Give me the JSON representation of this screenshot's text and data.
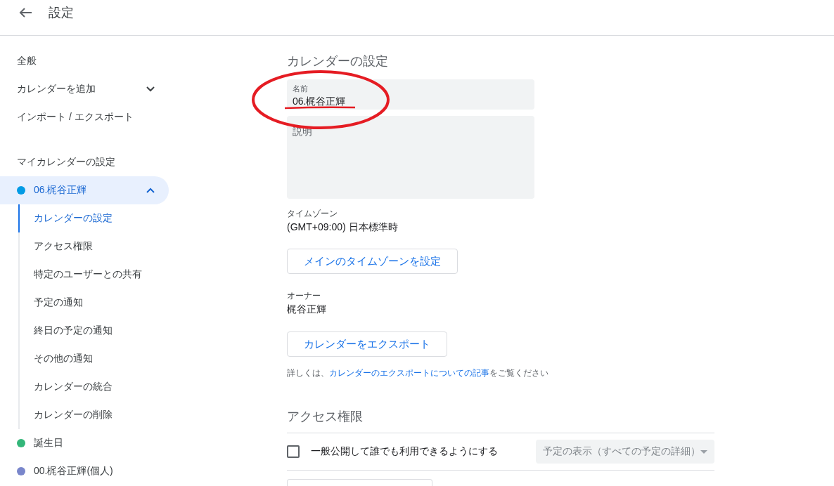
{
  "header": {
    "title": "設定"
  },
  "sidebar": {
    "items": [
      {
        "label": "全般",
        "kind": "link"
      },
      {
        "label": "カレンダーを追加",
        "kind": "expandable",
        "expanded": false
      },
      {
        "label": "インポート / エクスポート",
        "kind": "link"
      }
    ],
    "section_title": "マイカレンダーの設定",
    "calendars": [
      {
        "name": "06.梶谷正輝",
        "color": "#039be5",
        "selected": true,
        "expanded": true,
        "children": [
          {
            "label": "カレンダーの設定",
            "selected": true
          },
          {
            "label": "アクセス権限",
            "selected": false
          },
          {
            "label": "特定のユーザーとの共有",
            "selected": false
          },
          {
            "label": "予定の通知",
            "selected": false
          },
          {
            "label": "終日の予定の通知",
            "selected": false
          },
          {
            "label": "その他の通知",
            "selected": false
          },
          {
            "label": "カレンダーの統合",
            "selected": false
          },
          {
            "label": "カレンダーの削除",
            "selected": false
          }
        ]
      },
      {
        "name": "誕生日",
        "color": "#33b679",
        "selected": false
      },
      {
        "name": "00.梶谷正輝(個人)",
        "color": "#7986cb",
        "selected": false
      }
    ]
  },
  "calendar_settings": {
    "title": "カレンダーの設定",
    "name_field": {
      "label": "名前",
      "value": "06.梶谷正輝"
    },
    "description_field": {
      "placeholder": "説明"
    },
    "time_zone": {
      "label": "タイムゾーン",
      "value": "(GMT+09:00) 日本標準時"
    },
    "time_zone_button": "メインのタイムゾーンを設定",
    "owner": {
      "label": "オーナー",
      "value": "梶谷正輝"
    },
    "export_button": "カレンダーをエクスポート",
    "help": {
      "before": "詳しくは、",
      "link": "カレンダーのエクスポートについての記事",
      "after": "をご覧ください"
    }
  },
  "access": {
    "title": "アクセス権限",
    "public_checkbox": {
      "label": "一般公開して誰でも利用できるようにする",
      "checked": false
    },
    "visibility_select": {
      "value": "予定の表示（すべての予定の詳細）",
      "disabled": true
    }
  }
}
